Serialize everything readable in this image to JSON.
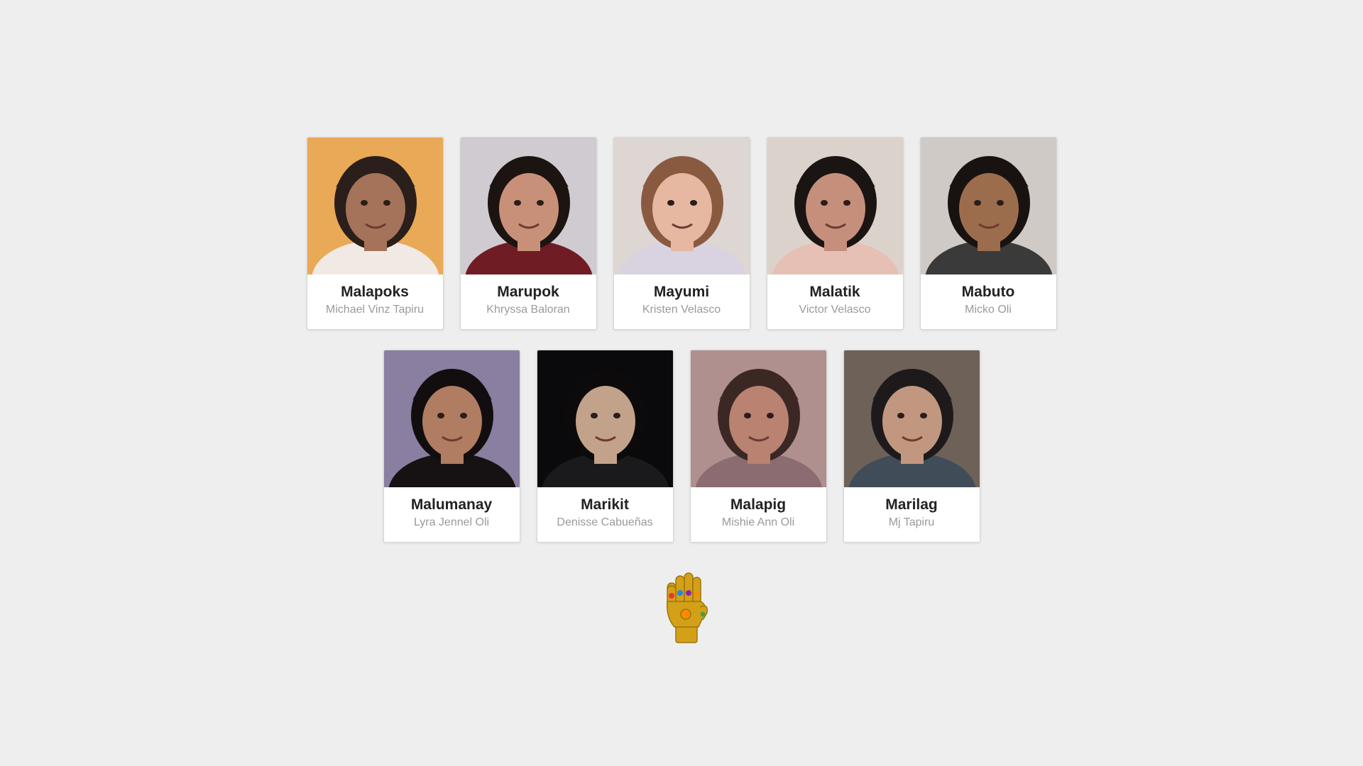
{
  "cards_row1": [
    {
      "nickname": "Malapoks",
      "name": "Michael Vinz Tapiru",
      "photo": {
        "bg": "#e9a957",
        "skin": "#a5735a",
        "hair": "#2a1f1a",
        "shirt": "#f1e9e4"
      }
    },
    {
      "nickname": "Marupok",
      "name": "Khryssa Baloran",
      "photo": {
        "bg": "#cfcbd1",
        "skin": "#c99079",
        "hair": "#1c1410",
        "shirt": "#6f1c24"
      }
    },
    {
      "nickname": "Mayumi",
      "name": "Kristen Velasco",
      "photo": {
        "bg": "#ddd6d3",
        "skin": "#e7b8a1",
        "hair": "#8a5a40",
        "shirt": "#d9d2e0"
      }
    },
    {
      "nickname": "Malatik",
      "name": "Victor Velasco",
      "photo": {
        "bg": "#dcd2cc",
        "skin": "#c58f7c",
        "hair": "#1a1513",
        "shirt": "#e6c0b4"
      }
    },
    {
      "nickname": "Mabuto",
      "name": "Micko Oli",
      "photo": {
        "bg": "#cfcac6",
        "skin": "#9c6d4d",
        "hair": "#181310",
        "shirt": "#3b3a3a"
      }
    }
  ],
  "cards_row2": [
    {
      "nickname": "Malumanay",
      "name": "Lyra Jennel Oli",
      "photo": {
        "bg": "#8a7fa0",
        "skin": "#b07d62",
        "hair": "#120e0f",
        "shirt": "#161213"
      }
    },
    {
      "nickname": "Marikit",
      "name": "Denisse Cabueñas",
      "photo": {
        "bg": "#0a0a0c",
        "skin": "#c3a28b",
        "hair": "#0c0a0a",
        "shirt": "#1a1a1d"
      }
    },
    {
      "nickname": "Malapig",
      "name": "Mishie Ann Oli",
      "photo": {
        "bg": "#b0908e",
        "skin": "#b98271",
        "hair": "#3b2824",
        "shirt": "#8b6c70"
      }
    },
    {
      "nickname": "Marilag",
      "name": "Mj Tapiru",
      "photo": {
        "bg": "#6e6258",
        "skin": "#c1987f",
        "hair": "#1e1a1c",
        "shirt": "#414c59"
      }
    }
  ],
  "gauntlet": {
    "icon": "infinity-gauntlet-icon",
    "metal": "#d4a017",
    "stones": [
      "#e53935",
      "#1e88e5",
      "#8e24aa",
      "#fb8c00",
      "#43a047"
    ]
  }
}
